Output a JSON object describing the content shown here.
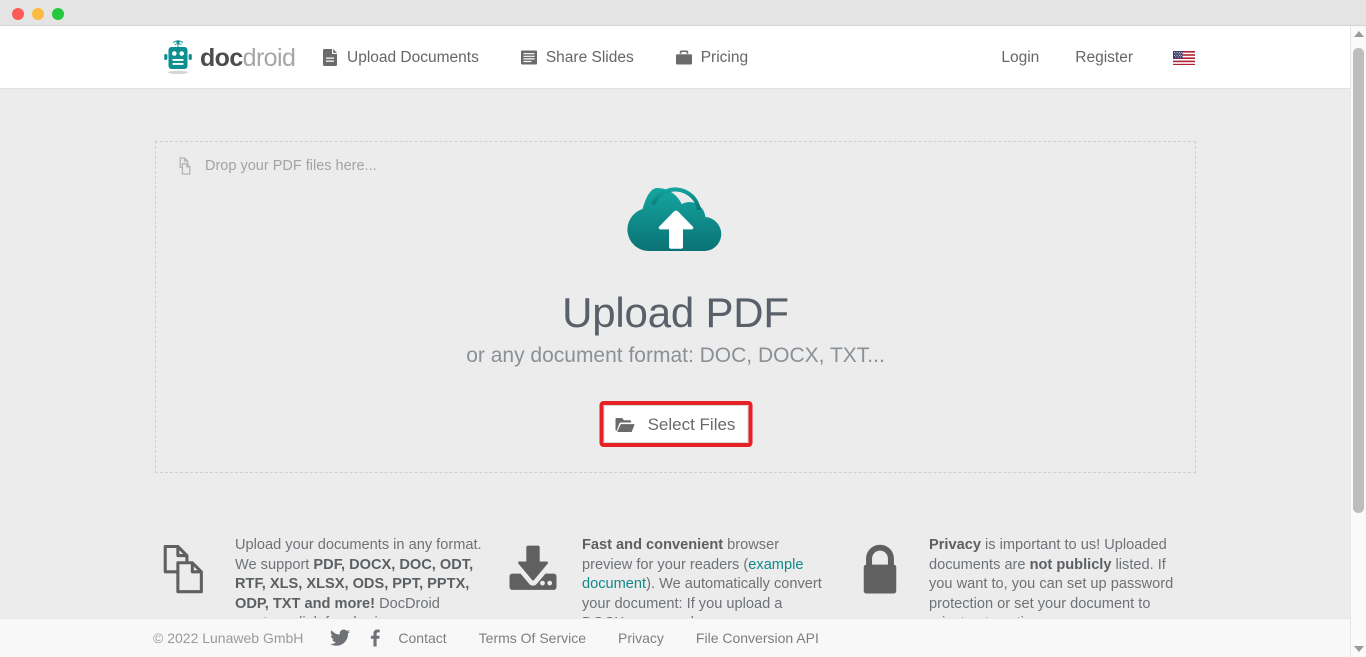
{
  "window": {
    "traffic_lights": [
      "close",
      "minimize",
      "maximize"
    ]
  },
  "header": {
    "brand": {
      "icon": "robot-logo-icon",
      "text_bold": "doc",
      "text_light": "droid"
    },
    "nav": [
      {
        "label": "Upload Documents",
        "icon": "document-icon"
      },
      {
        "label": "Share Slides",
        "icon": "slides-icon"
      },
      {
        "label": "Pricing",
        "icon": "briefcase-icon"
      }
    ],
    "account": [
      {
        "label": "Login"
      },
      {
        "label": "Register"
      }
    ],
    "language": {
      "icon": "us-flag-icon",
      "label": "English (US)"
    }
  },
  "dropzone": {
    "hint": "Drop your PDF files here...",
    "hint_icon": "copy-files-icon",
    "cloud_icon": "cloud-upload-icon",
    "title": "Upload PDF",
    "subtitle": "or any document format: DOC, DOCX, TXT...",
    "select_button": {
      "label": "Select Files",
      "icon": "folder-open-icon",
      "highlighted": true,
      "highlight_color": "#e82127"
    }
  },
  "features": [
    {
      "icon": "documents-stack-icon",
      "segments": [
        {
          "text": "Upload your documents in any format. We support ",
          "style": "normal"
        },
        {
          "text": "PDF, DOCX, DOC, ODT, RTF, XLS, XLSX, ODS, PPT, PPTX, ODP, TXT and more!",
          "style": "bold"
        },
        {
          "text": " DocDroid creates a link for sharing",
          "style": "normal"
        }
      ]
    },
    {
      "icon": "download-drive-icon",
      "segments": [
        {
          "text": "Fast and convenient",
          "style": "bold"
        },
        {
          "text": " browser preview for your readers (",
          "style": "normal"
        },
        {
          "text": "example document",
          "style": "link"
        },
        {
          "text": "). We automatically convert your document: If you upload a DOCX, your readers can",
          "style": "normal"
        }
      ]
    },
    {
      "icon": "lock-icon",
      "segments": [
        {
          "text": "Privacy",
          "style": "bold"
        },
        {
          "text": " is important to us! Uploaded documents are ",
          "style": "normal"
        },
        {
          "text": "not publicly",
          "style": "bold"
        },
        {
          "text": " listed. If you want to, you can set up password protection or set your document to private at anytime",
          "style": "normal"
        }
      ]
    }
  ],
  "footer": {
    "copyright": "© 2022 Lunaweb GmbH",
    "social": [
      {
        "icon": "twitter-icon",
        "label": "Twitter"
      },
      {
        "icon": "facebook-icon",
        "label": "Facebook"
      }
    ],
    "links": [
      {
        "label": "Contact"
      },
      {
        "label": "Terms Of Service"
      },
      {
        "label": "Privacy"
      },
      {
        "label": "File Conversion API"
      }
    ]
  },
  "scrollbar": {
    "up_arrow": "scroll-up-arrow",
    "down_arrow": "scroll-down-arrow",
    "thumb": "scroll-thumb"
  },
  "colors": {
    "brand_teal": "#0b8f90",
    "page_bg": "#ececec",
    "header_bg": "#ffffff",
    "highlight_red": "#e82127"
  }
}
